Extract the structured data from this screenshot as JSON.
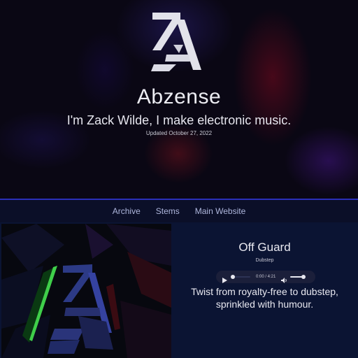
{
  "header": {
    "logo_label": "ZA",
    "title": "Abzense",
    "tagline": "I'm Zack Wilde, I make electronic music.",
    "updated": "Updated October 27, 2022"
  },
  "nav": {
    "items": [
      {
        "label": "Archive"
      },
      {
        "label": "Stems"
      },
      {
        "label": "Main Website"
      }
    ]
  },
  "track": {
    "title": "Off Guard",
    "genre": "Dubstep",
    "player": {
      "time": "0:00 / 4:21",
      "position_fraction": 0,
      "volume_fraction": 1
    },
    "description": "Twist from royalty-free to dubstep, sprinkled with humour."
  },
  "colors": {
    "accent": "#2a2fb8",
    "card_bg": "#0b1433",
    "nav_bg": "#0b0f28",
    "nav_link": "#aeb6dc"
  }
}
